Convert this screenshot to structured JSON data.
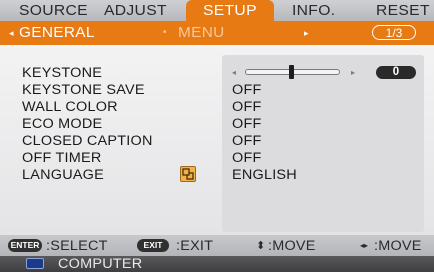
{
  "tabs": [
    {
      "label": "SOURCE"
    },
    {
      "label": "ADJUST"
    },
    {
      "label": "SETUP"
    },
    {
      "label": "INFO."
    },
    {
      "label": "RESET"
    }
  ],
  "subbar": {
    "left_arrow": "◂",
    "current": "GENERAL",
    "dot": "•",
    "next": "MENU",
    "right_arrow": "▸",
    "page": "1/3"
  },
  "settings": [
    {
      "label": "KEYSTONE",
      "value": ""
    },
    {
      "label": "KEYSTONE SAVE",
      "value": "OFF"
    },
    {
      "label": "WALL COLOR",
      "value": "OFF"
    },
    {
      "label": "ECO MODE",
      "value": "OFF"
    },
    {
      "label": "CLOSED CAPTION",
      "value": "OFF"
    },
    {
      "label": "OFF TIMER",
      "value": "OFF"
    },
    {
      "label": "LANGUAGE",
      "value": "ENGLISH"
    }
  ],
  "keystone_slider": {
    "left_arrow": "◂",
    "right_arrow": "▸",
    "value": "0",
    "level": 0.5
  },
  "help": {
    "enter_btn": "ENTER",
    "select": ":SELECT",
    "exit_btn": "EXIT",
    "exit": ":EXIT",
    "move_glyph_v": "⬍",
    "move_v": ":MOVE",
    "move_glyph_h": "◂▸",
    "move_h": ":MOVE"
  },
  "source": {
    "label": "COMPUTER"
  },
  "colors": {
    "accent": "#e87a14",
    "panel": "#eeeeef",
    "bar": "#bfc0c3"
  }
}
